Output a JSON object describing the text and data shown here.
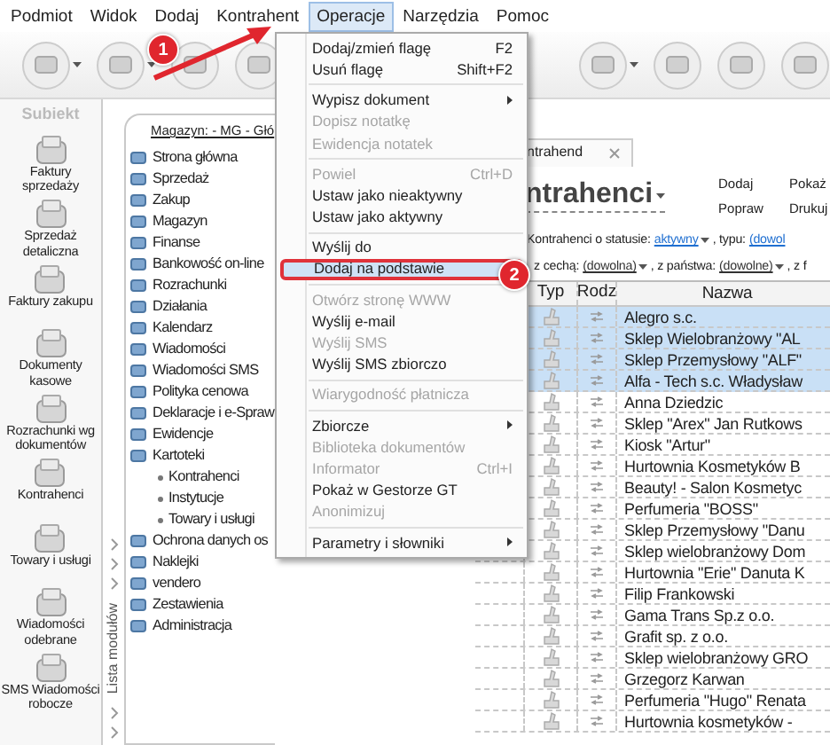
{
  "menubar": [
    {
      "label": "Podmiot",
      "selected": false
    },
    {
      "label": "Widok",
      "selected": false
    },
    {
      "label": "Dodaj",
      "selected": false
    },
    {
      "label": "Kontrahent",
      "selected": false
    },
    {
      "label": "Operacje",
      "selected": true
    },
    {
      "label": "Narzędzia",
      "selected": false
    },
    {
      "label": "Pomoc",
      "selected": false
    }
  ],
  "sidebar": {
    "logo": "Subiekt",
    "items": [
      {
        "label": "Faktury sprzedaży"
      },
      {
        "label": "Sprzedaż detaliczna"
      },
      {
        "label": "Faktury zakupu"
      },
      {
        "label": "Dokumenty kasowe"
      },
      {
        "label": "Rozrachunki wg dokumentów"
      },
      {
        "label": "Kontrahenci"
      },
      {
        "label": "Towary i usługi"
      },
      {
        "label": "Wiadomości odebrane"
      },
      {
        "label": "SMS Wiadomości robocze"
      }
    ]
  },
  "modules_strip": {
    "label": "Lista modułów"
  },
  "modules": {
    "header": "Magazyn: - MG - Głó",
    "items": [
      {
        "label": "Strona główna"
      },
      {
        "label": "Sprzedaż"
      },
      {
        "label": "Zakup"
      },
      {
        "label": "Magazyn"
      },
      {
        "label": "Finanse"
      },
      {
        "label": "Bankowość on-line"
      },
      {
        "label": "Rozrachunki"
      },
      {
        "label": "Działania"
      },
      {
        "label": "Kalendarz"
      },
      {
        "label": "Wiadomości"
      },
      {
        "label": "Wiadomości SMS"
      },
      {
        "label": "Polityka cenowa"
      },
      {
        "label": "Deklaracje i e-Spraw"
      },
      {
        "label": "Ewidencje"
      },
      {
        "label": "Kartoteki",
        "children": [
          {
            "label": "Kontrahenci"
          },
          {
            "label": "Instytucje"
          },
          {
            "label": "Towary i usługi"
          }
        ]
      },
      {
        "label": "Ochrona danych os"
      },
      {
        "label": "Naklejki"
      },
      {
        "label": "vendero"
      },
      {
        "label": "Zestawienia"
      },
      {
        "label": "Administracja"
      }
    ]
  },
  "tab": {
    "label": "ntrahend"
  },
  "title": "ntrahenci",
  "actions": [
    "Dodaj",
    "Pokaż",
    "Popraw",
    "Drukuj"
  ],
  "filters": [
    [
      {
        "kind": "text",
        "text": "Kontrahenci o statusie:"
      },
      {
        "kind": "dropdown",
        "text": "aktywny"
      },
      {
        "kind": "text",
        "text": ", typu:"
      },
      {
        "kind": "link",
        "text": "(dowol"
      }
    ],
    [
      {
        "kind": "text",
        "text": "z cechą:"
      },
      {
        "kind": "dropdown",
        "text": "(dowolna)"
      },
      {
        "kind": "text",
        "text": ", z państwa:"
      },
      {
        "kind": "dropdown",
        "text": "(dowolne)"
      },
      {
        "kind": "text",
        "text": ", z f"
      }
    ]
  ],
  "table": {
    "columns": [
      "Typ",
      "Rodz",
      "Nazwa"
    ],
    "rows": [
      {
        "name": "Alegro s.c.",
        "selected": true
      },
      {
        "name": "Sklep Wielobranżowy  \"AL",
        "selected": true
      },
      {
        "name": "Sklep Przemysłowy \"ALF\"",
        "selected": true
      },
      {
        "name": "Alfa - Tech s.c. Władysław",
        "selected": true
      },
      {
        "name": "Anna Dziedzic",
        "selected": false
      },
      {
        "name": "Sklep \"Arex\" Jan Rutkows",
        "selected": false
      },
      {
        "name": "Kiosk \"Artur\"",
        "selected": false
      },
      {
        "name": "Hurtownia Kosmetyków B",
        "selected": false
      },
      {
        "name": "Beauty! - Salon Kosmetyc",
        "selected": false
      },
      {
        "name": "Perfumeria \"BOSS\"",
        "selected": false
      },
      {
        "name": "Sklep Przemysłowy \"Danu",
        "selected": false
      },
      {
        "name": "Sklep wielobranżowy Dom",
        "selected": false
      },
      {
        "name": "Hurtownia \"Erie\" Danuta K",
        "selected": false
      },
      {
        "name": "Filip Frankowski",
        "selected": false
      },
      {
        "name": "Gama Trans Sp.z o.o.",
        "selected": false
      },
      {
        "name": "Grafit sp. z o.o.",
        "selected": false
      },
      {
        "name": "Sklep wielobranżowy GRO",
        "selected": false
      },
      {
        "name": "Grzegorz Karwan",
        "selected": false
      },
      {
        "name": "Perfumeria \"Hugo\" Renata",
        "selected": false
      },
      {
        "name": "Hurtownia kosmetyków -",
        "selected": false
      }
    ]
  },
  "menu": [
    {
      "kind": "item",
      "label": "Dodaj/zmień flagę",
      "shortcut": "F2",
      "disabled": false,
      "submenu": false,
      "selected": false
    },
    {
      "kind": "item",
      "label": "Usuń flagę",
      "shortcut": "Shift+F2",
      "disabled": false,
      "submenu": false,
      "selected": false
    },
    {
      "kind": "separator"
    },
    {
      "kind": "item",
      "label": "Wypisz dokument",
      "disabled": false,
      "submenu": true,
      "selected": false
    },
    {
      "kind": "item",
      "label": "Dopisz notatkę",
      "disabled": true,
      "submenu": false,
      "selected": false
    },
    {
      "kind": "item",
      "label": "Ewidencja notatek",
      "disabled": true,
      "submenu": false,
      "selected": false
    },
    {
      "kind": "separator"
    },
    {
      "kind": "item",
      "label": "Powiel",
      "shortcut": "Ctrl+D",
      "disabled": true,
      "submenu": false,
      "selected": false
    },
    {
      "kind": "item",
      "label": "Ustaw jako nieaktywny",
      "disabled": false,
      "submenu": false,
      "selected": false
    },
    {
      "kind": "item",
      "label": "Ustaw jako aktywny",
      "disabled": false,
      "submenu": false,
      "selected": false
    },
    {
      "kind": "separator"
    },
    {
      "kind": "item",
      "label": "Wyślij do",
      "disabled": false,
      "submenu": false,
      "selected": false
    },
    {
      "kind": "item",
      "label": "Dodaj na podstawie",
      "disabled": false,
      "submenu": false,
      "selected": true
    },
    {
      "kind": "separator"
    },
    {
      "kind": "item",
      "label": "Otwórz stronę WWW",
      "disabled": true,
      "submenu": false,
      "selected": false
    },
    {
      "kind": "item",
      "label": "Wyślij e-mail",
      "disabled": false,
      "submenu": false,
      "selected": false
    },
    {
      "kind": "item",
      "label": "Wyślij SMS",
      "disabled": true,
      "submenu": false,
      "selected": false
    },
    {
      "kind": "item",
      "label": "Wyślij SMS zbiorczo",
      "disabled": false,
      "submenu": false,
      "selected": false
    },
    {
      "kind": "separator"
    },
    {
      "kind": "item",
      "label": "Wiarygodność płatnicza",
      "disabled": true,
      "submenu": false,
      "selected": false
    },
    {
      "kind": "separator"
    },
    {
      "kind": "item",
      "label": "Zbiorcze",
      "disabled": false,
      "submenu": true,
      "selected": false
    },
    {
      "kind": "item",
      "label": "Biblioteka dokumentów",
      "disabled": true,
      "submenu": false,
      "selected": false
    },
    {
      "kind": "item",
      "label": "Informator",
      "shortcut": "Ctrl+I",
      "disabled": true,
      "submenu": false,
      "selected": false
    },
    {
      "kind": "item",
      "label": "Pokaż w Gestorze GT",
      "disabled": false,
      "submenu": false,
      "selected": false
    },
    {
      "kind": "item",
      "label": "Anonimizuj",
      "disabled": true,
      "submenu": false,
      "selected": false
    },
    {
      "kind": "separator"
    },
    {
      "kind": "item",
      "label": "Parametry i słowniki",
      "disabled": false,
      "submenu": true,
      "selected": false
    }
  ],
  "callouts": [
    "1",
    "2"
  ]
}
